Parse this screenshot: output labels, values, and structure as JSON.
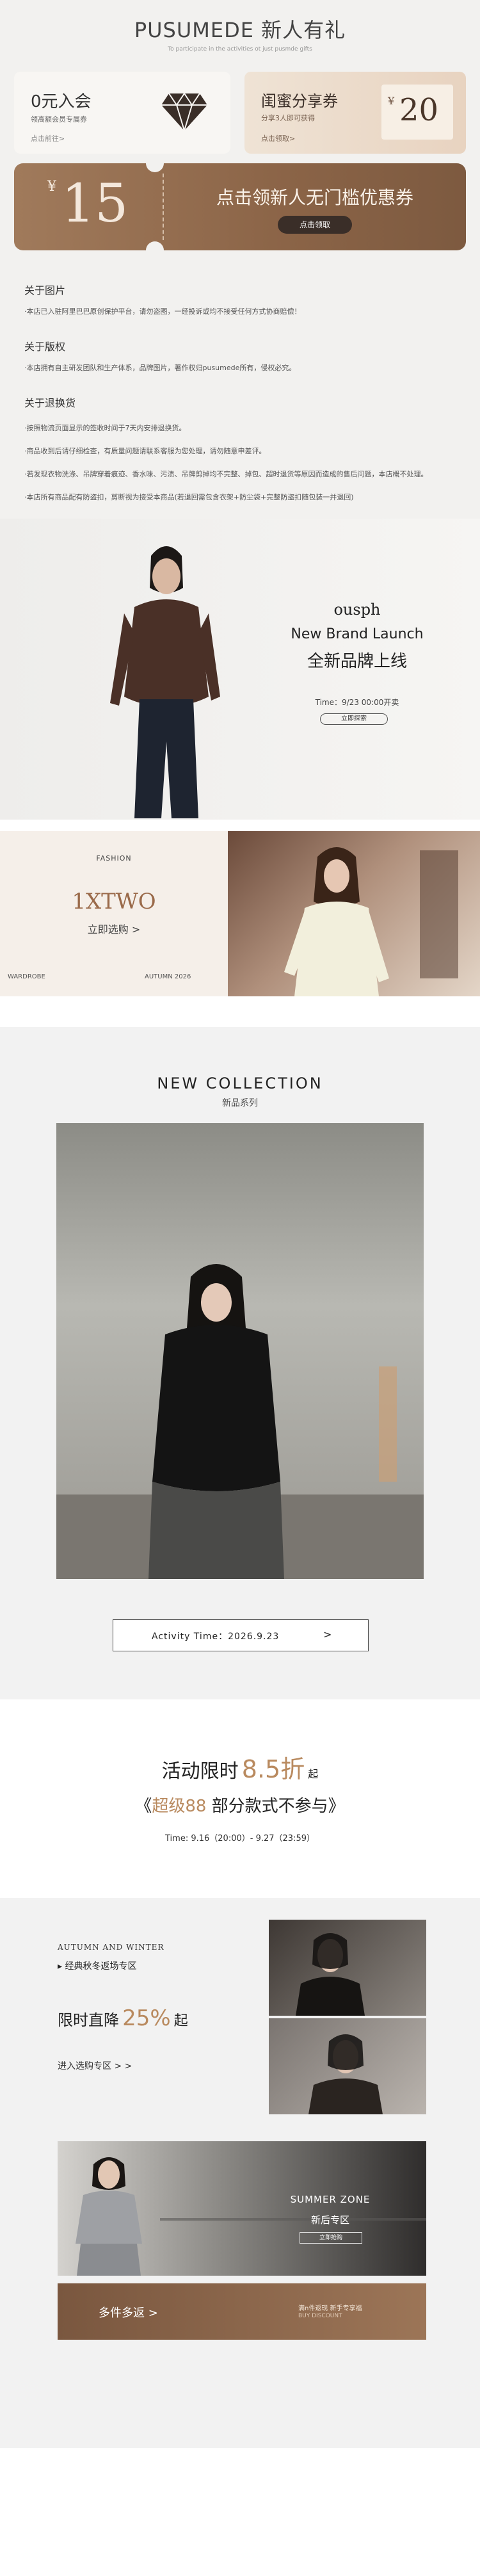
{
  "header": {
    "title": "PUSUMEDE 新人有礼",
    "subtitle": "To participate in the activities ot just pusmde gifts"
  },
  "cards": {
    "free": {
      "title": "0元入会",
      "desc": "领高额会员专属券",
      "link": "点击前往>"
    },
    "bestie": {
      "title": "闺蜜分享券",
      "desc": "分享3人即可获得",
      "link": "点击领取>",
      "currency": "¥",
      "amount": "20"
    }
  },
  "coupon": {
    "currency": "¥",
    "amount": "15",
    "title": "点击领新人无门槛优惠券",
    "button": "点击领取"
  },
  "policy": [
    {
      "heading": "关于图片",
      "lines": [
        "·本店已入驻阿里巴巴原创保护平台，请勿盗图，一经投诉或均不接受任何方式协商赔偿！"
      ]
    },
    {
      "heading": "关于版权",
      "lines": [
        "·本店拥有自主研发团队和生产体系，品牌图片，著作权归pusumede所有，侵权必究。"
      ]
    },
    {
      "heading": "关于退换货",
      "lines": [
        "·按照物流页面显示的签收时间于7天内安排退换货。",
        "·商品收到后请仔细检查，有质量问题请联系客服为您处理，请勿随意申差评。",
        "·若发现衣物洗涤、吊牌穿着痕迹、香水味、污渍、吊牌剪掉均不完整、掉包、超时退货等原因而造成的售后问题，本店概不处理。",
        "·本店所有商品配有防盗扣，剪断视为接受本商品(若退回需包含衣架+防尘袋+完整防盗扣随包装一并退回)"
      ]
    }
  ],
  "launch": {
    "brand": "ousph",
    "line1": "New Brand Launch",
    "line2": "全新品牌上线",
    "time": "Time：9/23 00:00开卖",
    "button": "立即探索"
  },
  "fashion": {
    "tag": "FASHION",
    "brand": "1XTWO",
    "cta": "立即选购 >",
    "left_label": "WARDROBE",
    "right_label": "AUTUMN 2026"
  },
  "collection": {
    "title": "NEW COLLECTION",
    "subtitle": "新品系列",
    "activity": "Activity Time：2026.9.23",
    "arrow": ">"
  },
  "discount": {
    "line1_prefix": "活动限时",
    "line1_value": "8.5折",
    "line1_suffix": "起",
    "line2_open": "《",
    "line2_accent": "超级88",
    "line2_rest": "部分款式不参与",
    "line2_close": "》",
    "time": "Time: 9.16（20:00）- 9.27（23:59）"
  },
  "autumn": {
    "en": "AUTUMN AND WINTER",
    "label": "▸ 经典秋冬返场专区",
    "promo_prefix": "限时直降",
    "promo_value": "25%",
    "promo_suffix": "起",
    "link": "进入选购专区 > >"
  },
  "summer": {
    "zone": "SUMMER ZONE",
    "title": "新后专区",
    "button": "立即抢购"
  },
  "bottom": {
    "cta": "多件多返  >",
    "note_line1": "满n件返现 新手专享福",
    "note_line2": "BUY DISCOUNT"
  },
  "colors": {
    "brown": "#8b6447",
    "accent": "#b98a5f",
    "dark": "#2a2421"
  }
}
